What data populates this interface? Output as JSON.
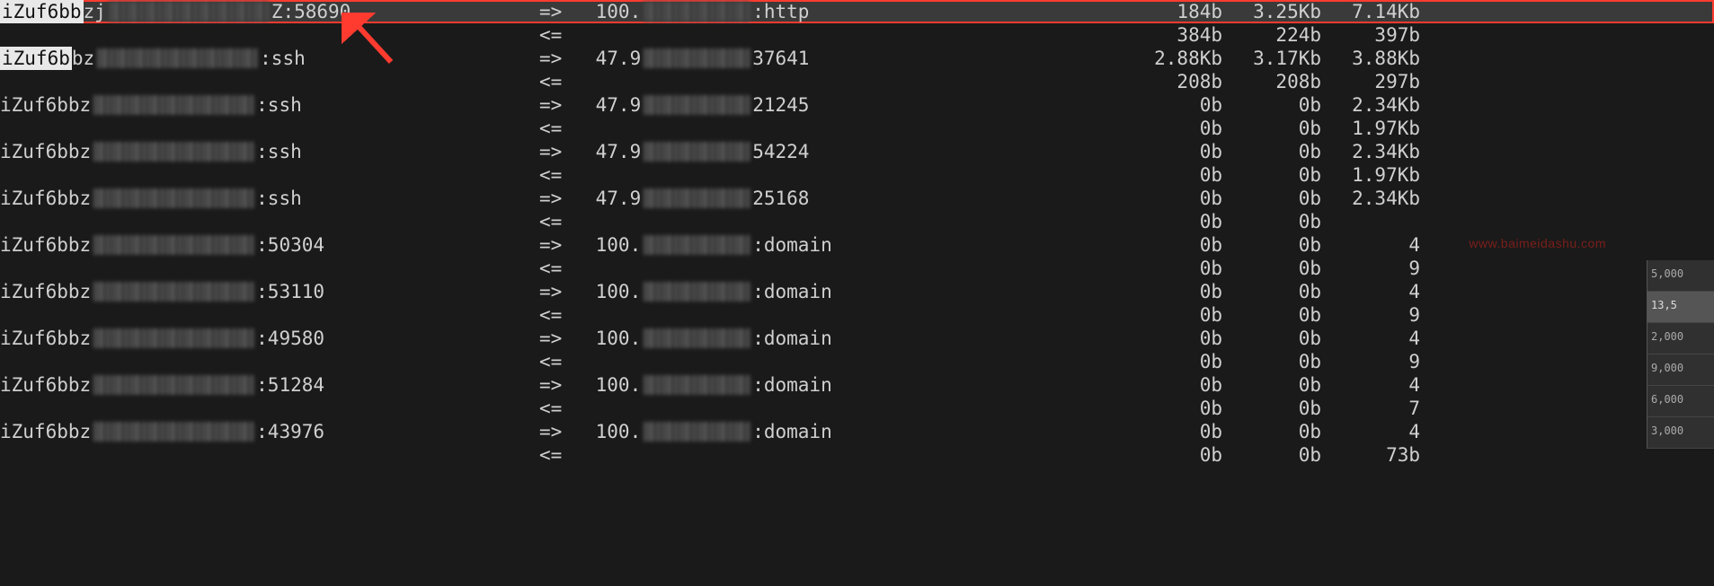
{
  "rows": [
    {
      "highlighted": true,
      "host_prefix": "iZuf6bb",
      "host_mid": "zj",
      "host_port": "Z:58690",
      "arrow": "=>",
      "remote_ip": "100.",
      "remote_port": ":http",
      "c1": "184b",
      "c2": "3.25Kb",
      "c3": "7.14Kb"
    },
    {
      "filler": true,
      "arrow": "<=",
      "c1": "384b",
      "c2": "224b",
      "c3": "397b"
    },
    {
      "host_prefix": "iZuf6b",
      "host_mid": "bz",
      "host_port": ":ssh",
      "arrow": "=>",
      "remote_ip": "47.9",
      "remote_port": "37641",
      "c1": "2.88Kb",
      "c2": "3.17Kb",
      "c3": "3.88Kb"
    },
    {
      "filler": true,
      "arrow": "<=",
      "c1": "208b",
      "c2": "208b",
      "c3": "297b"
    },
    {
      "host_prefix": "",
      "host_mid": "iZuf6bbz",
      "host_port": ":ssh",
      "arrow": "=>",
      "remote_ip": "47.9",
      "remote_port": "21245",
      "c1": "0b",
      "c2": "0b",
      "c3": "2.34Kb"
    },
    {
      "filler": true,
      "arrow": "<=",
      "c1": "0b",
      "c2": "0b",
      "c3": "1.97Kb"
    },
    {
      "host_prefix": "",
      "host_mid": "iZuf6bbz",
      "host_port": ":ssh",
      "arrow": "=>",
      "remote_ip": "47.9",
      "remote_port": "54224",
      "c1": "0b",
      "c2": "0b",
      "c3": "2.34Kb"
    },
    {
      "filler": true,
      "arrow": "<=",
      "c1": "0b",
      "c2": "0b",
      "c3": "1.97Kb"
    },
    {
      "host_prefix": "",
      "host_mid": "iZuf6bbz",
      "host_port": ":ssh",
      "arrow": "=>",
      "remote_ip": "47.9",
      "remote_port": "25168",
      "c1": "0b",
      "c2": "0b",
      "c3": "2.34Kb"
    },
    {
      "filler": true,
      "arrow": "<=",
      "c1": "0b",
      "c2": "0b",
      "c3": ""
    },
    {
      "host_prefix": "",
      "host_mid": "iZuf6bbz",
      "host_port": ":50304",
      "arrow": "=>",
      "remote_ip": "100.",
      "remote_port": ":domain",
      "c1": "0b",
      "c2": "0b",
      "c3": "4"
    },
    {
      "filler": true,
      "arrow": "<=",
      "c1": "0b",
      "c2": "0b",
      "c3": "9"
    },
    {
      "host_prefix": "",
      "host_mid": "iZuf6bbz",
      "host_port": ":53110",
      "arrow": "=>",
      "remote_ip": "100.",
      "remote_port": ":domain",
      "c1": "0b",
      "c2": "0b",
      "c3": "4"
    },
    {
      "filler": true,
      "arrow": "<=",
      "c1": "0b",
      "c2": "0b",
      "c3": "9"
    },
    {
      "host_prefix": "",
      "host_mid": "iZuf6bbz",
      "host_port": ":49580",
      "arrow": "=>",
      "remote_ip": "100.",
      "remote_port": ":domain",
      "c1": "0b",
      "c2": "0b",
      "c3": "4"
    },
    {
      "filler": true,
      "arrow": "<=",
      "c1": "0b",
      "c2": "0b",
      "c3": "9"
    },
    {
      "host_prefix": "",
      "host_mid": "iZuf6bbz",
      "host_port": ":51284",
      "arrow": "=>",
      "remote_ip": "100.",
      "remote_port": ":domain",
      "c1": "0b",
      "c2": "0b",
      "c3": "4"
    },
    {
      "filler": true,
      "arrow": "<=",
      "c1": "0b",
      "c2": "0b",
      "c3": "7"
    },
    {
      "host_prefix": "",
      "host_mid": "iZuf6bbz",
      "host_port": ":43976",
      "arrow": "=>",
      "remote_ip": "100.",
      "remote_port": ":domain",
      "c1": "0b",
      "c2": "0b",
      "c3": "4"
    },
    {
      "filler": true,
      "arrow": "<=",
      "c1": "0b",
      "c2": "0b",
      "c3": "73b"
    }
  ],
  "watermark": "www.baimeidashu.com",
  "mini_scales": [
    "5,000",
    "13,5",
    "2,000",
    "9,000",
    "6,000",
    "3,000"
  ]
}
